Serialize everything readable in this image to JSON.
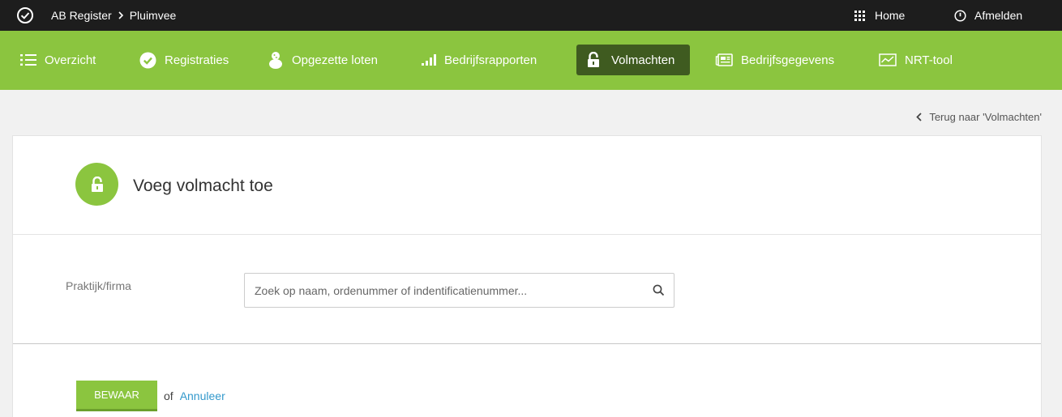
{
  "topbar": {
    "breadcrumb": [
      "AB Register",
      "Pluimvee"
    ],
    "home_label": "Home",
    "logout_label": "Afmelden"
  },
  "nav": {
    "items": [
      {
        "label": "Overzicht",
        "icon": "list-icon"
      },
      {
        "label": "Registraties",
        "icon": "check-circle-icon"
      },
      {
        "label": "Opgezette loten",
        "icon": "chick-icon"
      },
      {
        "label": "Bedrijfsrapporten",
        "icon": "signal-bars-icon"
      },
      {
        "label": "Volmachten",
        "icon": "lock-icon",
        "active": true
      },
      {
        "label": "Bedrijfsgegevens",
        "icon": "newspaper-icon"
      },
      {
        "label": "NRT-tool",
        "icon": "chart-icon"
      }
    ]
  },
  "back_link": "Terug naar 'Volmachten'",
  "card": {
    "title": "Voeg volmacht toe",
    "field_label": "Praktijk/firma",
    "search_placeholder": "Zoek op naam, ordenummer of indentificatienummer...",
    "save_label": "BEWAAR",
    "or_text": "of",
    "cancel_label": "Annuleer"
  },
  "colors": {
    "topbar": "#1d1d1d",
    "nav_green": "#8bc53f",
    "nav_active": "#3f5b20",
    "link_blue": "#3399cc"
  }
}
